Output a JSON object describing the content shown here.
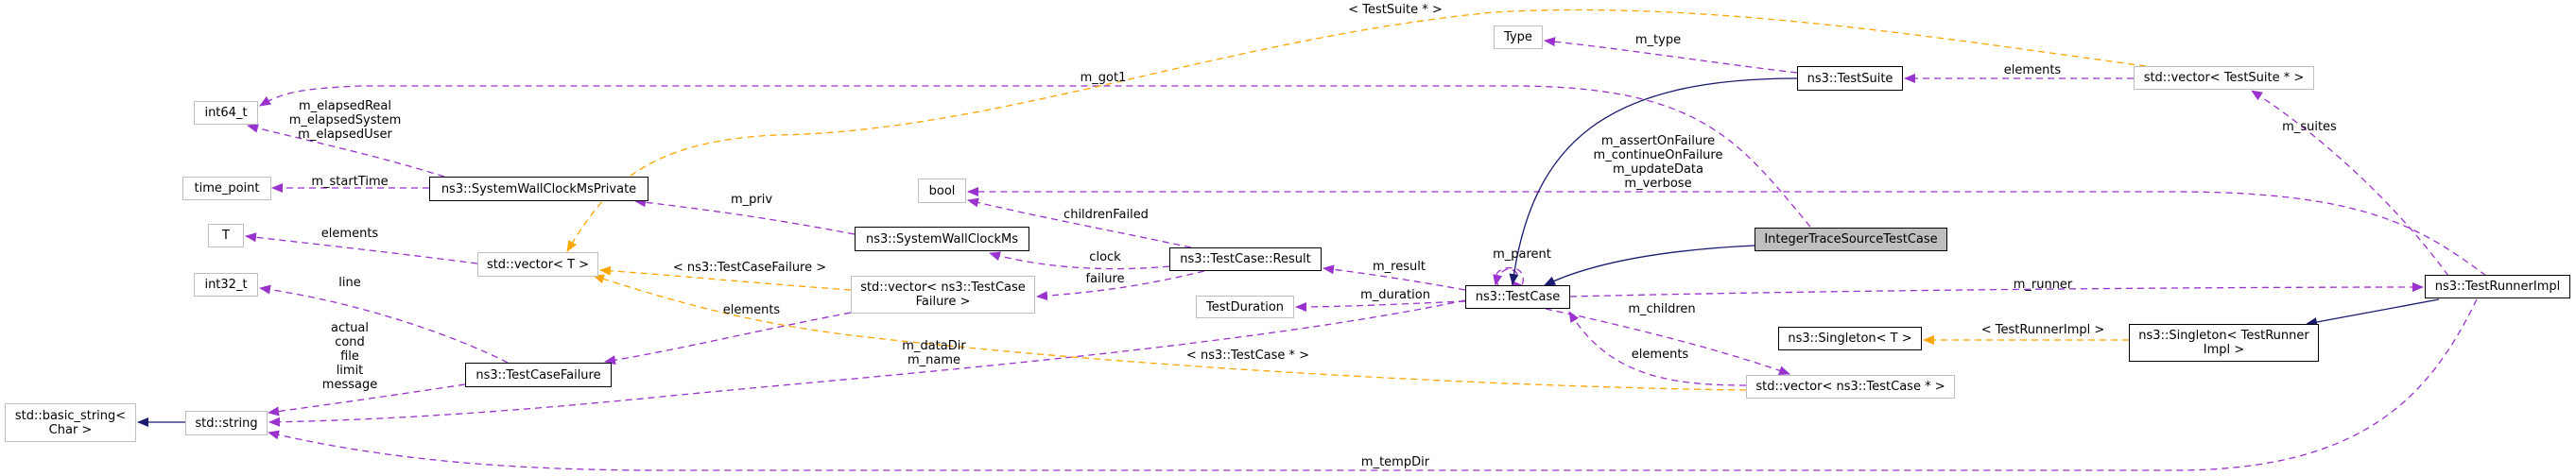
{
  "diagram": {
    "type": "doxygen-collaboration-graph",
    "colors": {
      "usage_edge": "#9a32cd",
      "template_edge": "#ffa500",
      "inheritance_edge": "#191970",
      "focus_fill": "#bfbfbf",
      "external_border": "#bfbfbf",
      "documented_border": "#000000"
    },
    "nodes": {
      "int64_t": "int64_t",
      "time_point": "time_point",
      "T": "T",
      "int32_t": "int32_t",
      "basic_string": "std::basic_string<\nChar >",
      "string": "std::string",
      "wallclock_private": "ns3::SystemWallClockMsPrivate",
      "vector_t": "std::vector< T >",
      "testcasefailure": "ns3::TestCaseFailure",
      "bool": "bool",
      "wallclock": "ns3::SystemWallClockMs",
      "vector_failure": "std::vector< ns3::TestCase\nFailure >",
      "result": "ns3::TestCase::Result",
      "testduration": "TestDuration",
      "testcase": "ns3::TestCase",
      "type": "Type",
      "testsuite": "ns3::TestSuite",
      "vector_suite": "std::vector< TestSuite * >",
      "integer_trace": "IntegerTraceSourceTestCase",
      "singleton_t": "ns3::Singleton< T >",
      "singleton_runner": "ns3::Singleton< TestRunner\nImpl >",
      "vector_testcase": "std::vector< ns3::TestCase * >",
      "runner": "ns3::TestRunnerImpl"
    },
    "edge_labels": {
      "elapsed": "m_elapsedReal\nm_elapsedSystem\nm_elapsedUser",
      "start_time": "m_startTime",
      "elements_t": "elements",
      "line": "line",
      "failure_fields": "actual\ncond\nfile\nlimit\nmessage",
      "got1": "m_got1",
      "priv": "m_priv",
      "children_failed": "childrenFailed",
      "clock": "clock",
      "failure": "failure",
      "tpl_failure": "< ns3::TestCaseFailure >",
      "elements_failure": "elements",
      "data_dir": "m_dataDir\nm_name",
      "tpl_testcase": "< ns3::TestCase * >",
      "result": "m_result",
      "duration": "m_duration",
      "parent": "m_parent",
      "children": "m_children",
      "elements_testcase": "elements",
      "tpl_suite": "< TestSuite * >",
      "type": "m_type",
      "elements_suite": "elements",
      "flags": "m_assertOnFailure\nm_continueOnFailure\nm_updateData\nm_verbose",
      "runner": "m_runner",
      "suites": "m_suites",
      "tpl_runner": "< TestRunnerImpl >",
      "temp_dir": "m_tempDir"
    }
  }
}
